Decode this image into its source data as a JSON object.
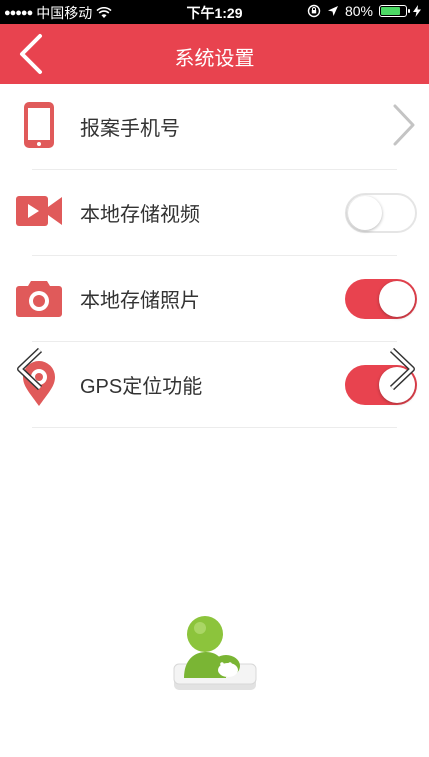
{
  "status_bar": {
    "carrier": "中国移动",
    "time": "下午1:29",
    "battery": "80%",
    "battery_level": 0.8
  },
  "nav": {
    "title": "系统设置",
    "back_icon": "chevron-left-icon"
  },
  "settings": [
    {
      "label": "报案手机号",
      "icon": "phone-icon",
      "control": "chevron"
    },
    {
      "label": "本地存储视频",
      "icon": "video-camera-icon",
      "control": "toggle",
      "state": "off"
    },
    {
      "label": "本地存储照片",
      "icon": "camera-icon",
      "control": "toggle",
      "state": "on"
    },
    {
      "label": "GPS定位功能",
      "icon": "location-pin-icon",
      "control": "toggle",
      "state": "on"
    }
  ],
  "colors": {
    "accent": "#e8434f",
    "icon": "#e05a5a",
    "toggle_on": "#e8434f",
    "status_bar": "#000000"
  }
}
